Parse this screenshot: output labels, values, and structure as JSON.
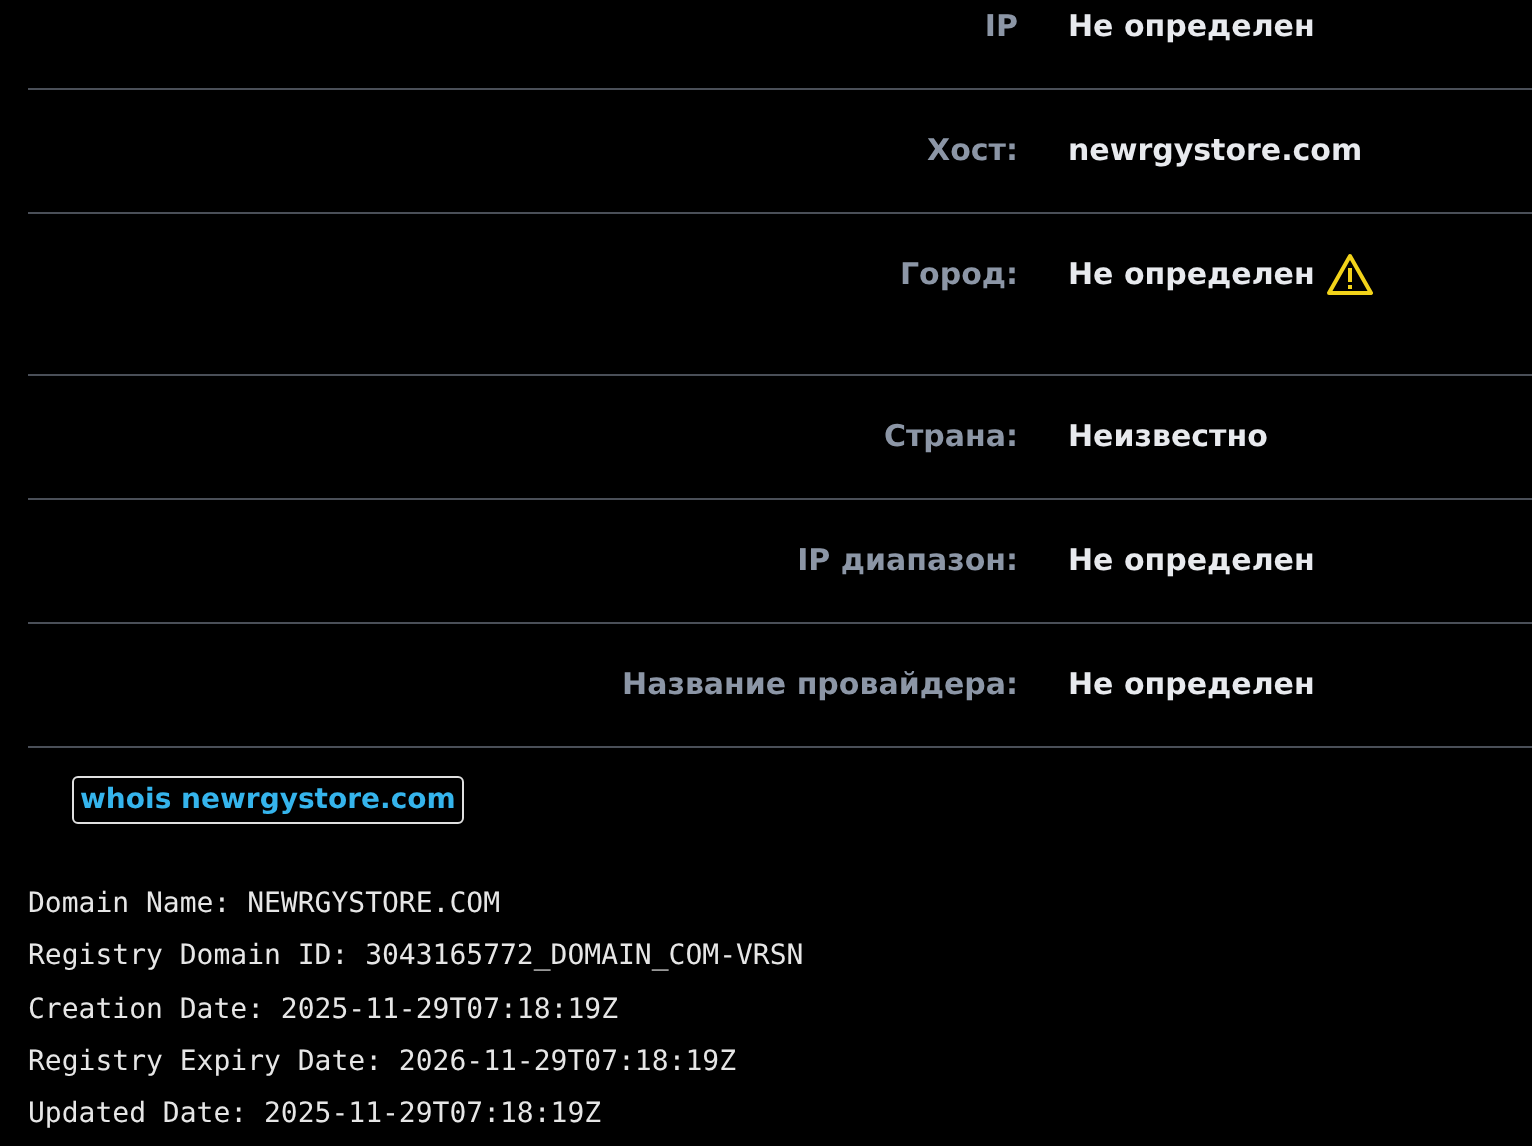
{
  "info_rows": [
    {
      "label": "IP",
      "value": "Не определен",
      "warning": false
    },
    {
      "label": "Хост:",
      "value": "newrgystore.com",
      "warning": false
    },
    {
      "label": "Город:",
      "value": "Не определен",
      "warning": true
    },
    {
      "label": "Страна:",
      "value": "Неизвестно",
      "warning": false
    },
    {
      "label": "IP диапазон:",
      "value": "Не определен",
      "warning": false
    },
    {
      "label": "Название провайдера:",
      "value": "Не определен",
      "warning": false
    }
  ],
  "whois_button": "whois newrgystore.com",
  "whois_lines": [
    "Domain Name: NEWRGYSTORE.COM",
    "Registry Domain ID: 3043165772_DOMAIN_COM-VRSN",
    "Creation Date: 2025-11-29T07:18:19Z",
    "Registry Expiry Date: 2026-11-29T07:18:19Z",
    "Updated Date: 2025-11-29T07:18:19Z"
  ]
}
